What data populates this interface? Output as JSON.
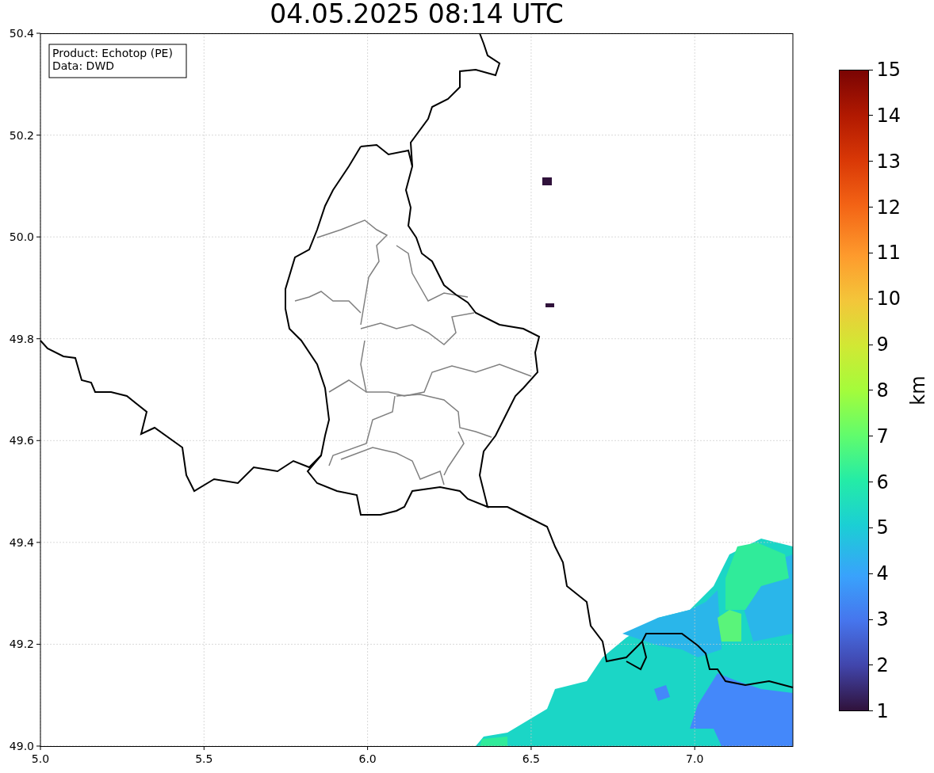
{
  "title": "04.05.2025 08:14 UTC",
  "info_box": [
    "Product: Echotop (PE)",
    "Data: DWD"
  ],
  "x_axis": {
    "ticks": [
      "5.0",
      "5.5",
      "6.0",
      "6.5",
      "7.0"
    ]
  },
  "y_axis": {
    "ticks": [
      "50.4",
      "50.2",
      "50.0",
      "49.8",
      "49.6",
      "49.4",
      "49.2",
      "49.0"
    ]
  },
  "colorbar": {
    "label": "km",
    "ticks": [
      "15",
      "14",
      "13",
      "12",
      "11",
      "10",
      "9",
      "8",
      "7",
      "6",
      "5",
      "4",
      "3",
      "2",
      "1"
    ]
  }
}
